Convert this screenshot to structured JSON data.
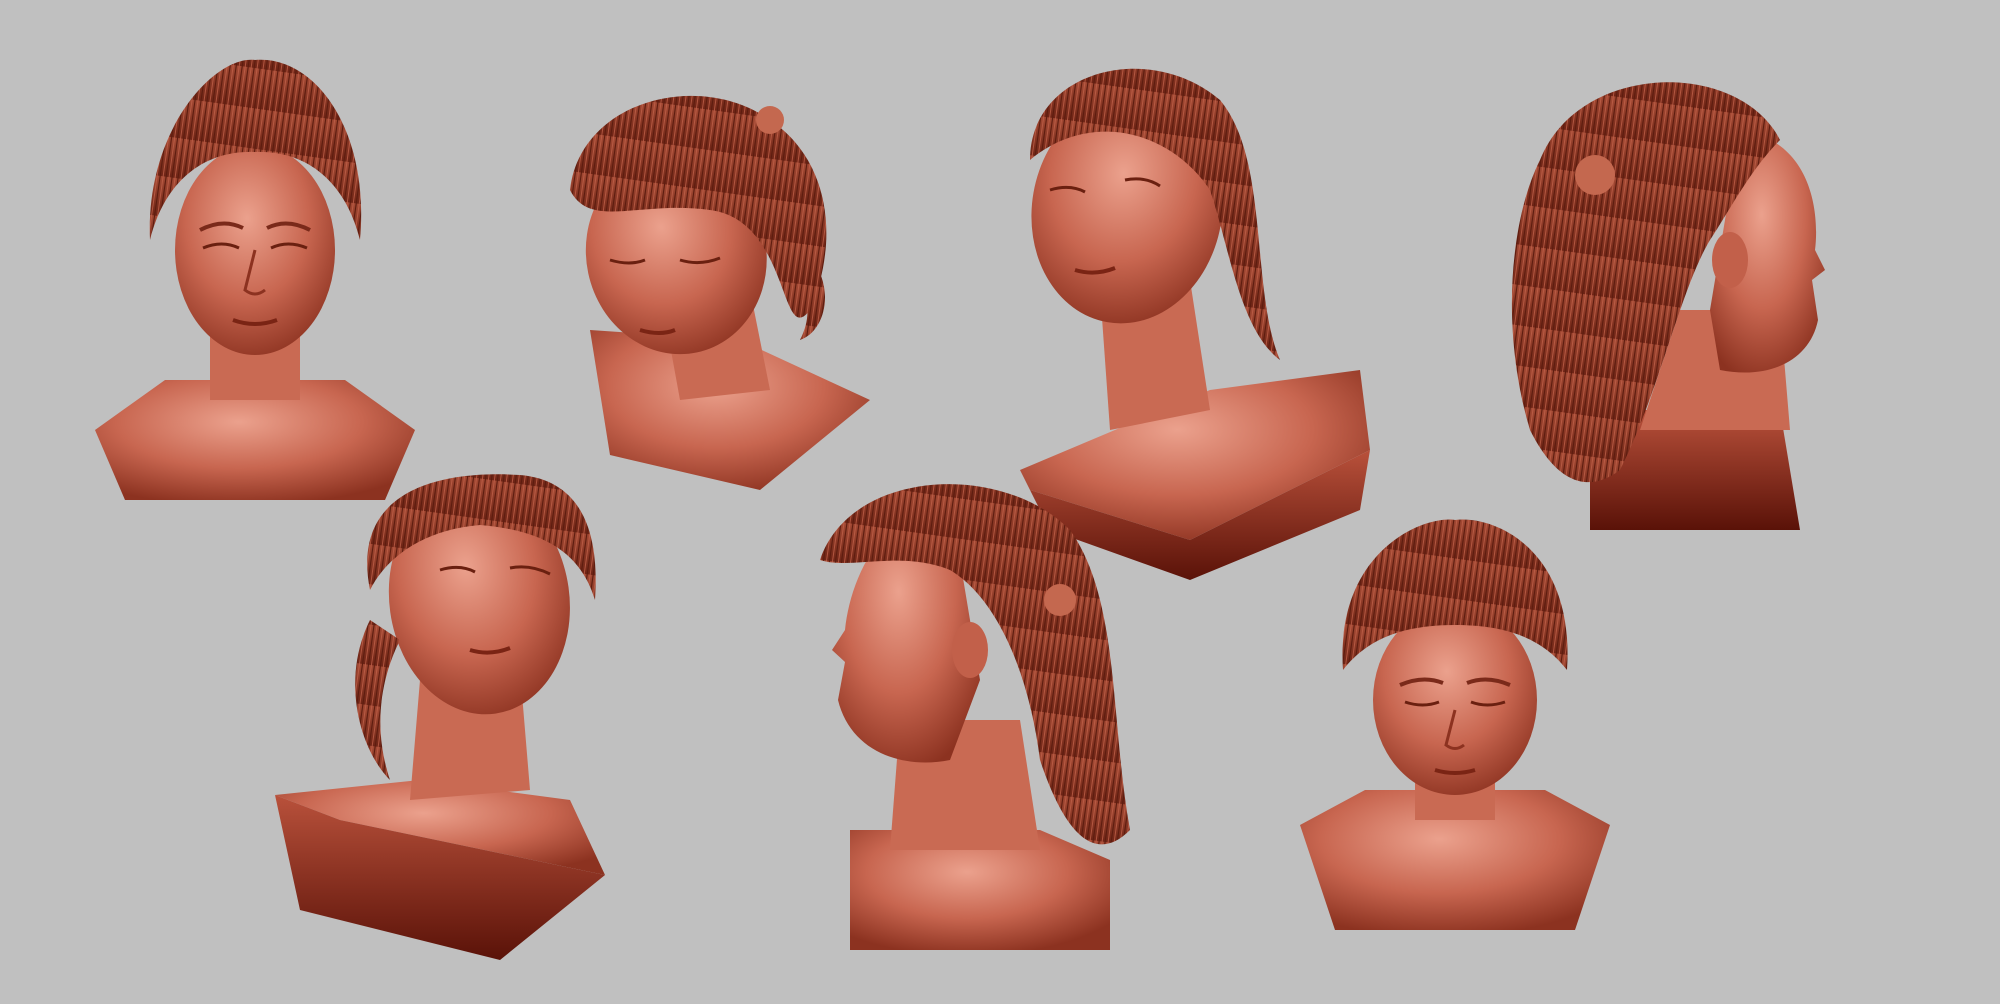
{
  "scene": {
    "background_color": "#c0c0c0",
    "clay_light": "#d9826f",
    "clay_mid": "#b85a45",
    "clay_dark": "#7a2414",
    "hair_color": "#8e3b28",
    "busts": [
      {
        "view": "front"
      },
      {
        "view": "three-quarter-down-left"
      },
      {
        "view": "three-quarter-up-left"
      },
      {
        "view": "profile-right-back"
      },
      {
        "view": "from-below-left"
      },
      {
        "view": "profile-left"
      },
      {
        "view": "top-down-front"
      }
    ]
  }
}
